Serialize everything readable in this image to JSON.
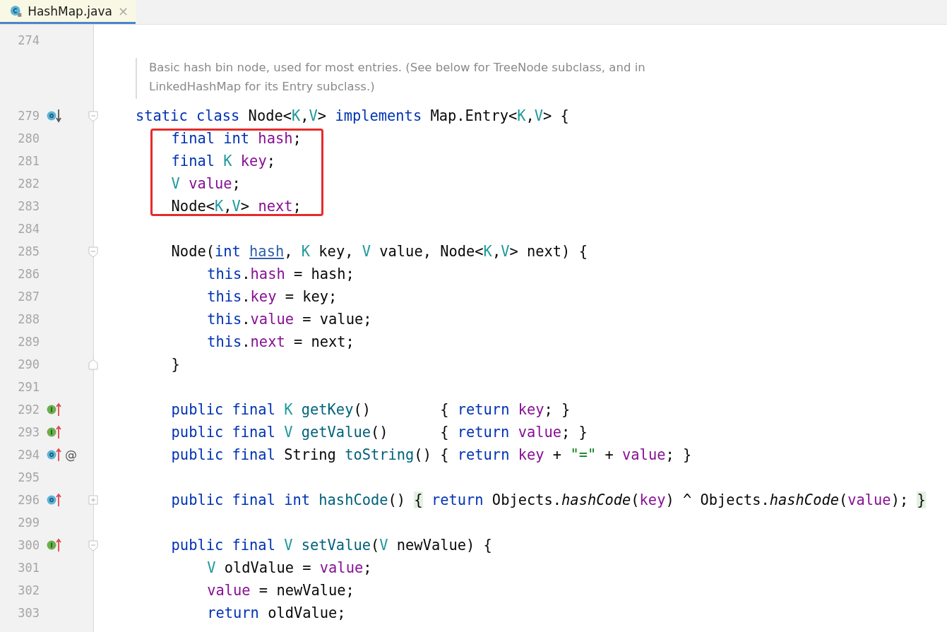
{
  "tab": {
    "label": "HashMap.java",
    "selected": true,
    "close": "×"
  },
  "lines": [
    {
      "number": "274"
    },
    {
      "kind": "doc",
      "text": [
        "Basic hash bin node, used for most entries. (See below for TreeNode subclass, and in",
        "LinkedHashMap for its Entry subclass.)"
      ]
    },
    {
      "number": "279",
      "gutter_icon": {
        "kind": "subclassed"
      },
      "fold": {
        "kind": "start"
      },
      "tokens": [
        {
          "kind": "kw",
          "t": "static class"
        },
        {
          "kind": "plain",
          "t": " Node<"
        },
        {
          "kind": "type",
          "t": "K"
        },
        {
          "kind": "plain",
          "t": ","
        },
        {
          "kind": "type",
          "t": "V"
        },
        {
          "kind": "plain",
          "t": "> "
        },
        {
          "kind": "kw",
          "t": "implements"
        },
        {
          "kind": "plain",
          "t": " Map.Entry<"
        },
        {
          "kind": "type",
          "t": "K"
        },
        {
          "kind": "plain",
          "t": ","
        },
        {
          "kind": "type",
          "t": "V"
        },
        {
          "kind": "plain",
          "t": "> {"
        }
      ],
      "children": [
        {
          "number": "280",
          "boxed": true,
          "tokens": [
            {
              "kind": "kw",
              "t": "final int "
            },
            {
              "kind": "field",
              "t": "hash"
            },
            {
              "kind": "plain",
              "t": ";"
            }
          ]
        },
        {
          "number": "281",
          "boxed": true,
          "tokens": [
            {
              "kind": "kw",
              "t": "final "
            },
            {
              "kind": "type",
              "t": "K "
            },
            {
              "kind": "field",
              "t": "key"
            },
            {
              "kind": "plain",
              "t": ";"
            }
          ]
        },
        {
          "number": "282",
          "boxed": true,
          "tokens": [
            {
              "kind": "type",
              "t": "V "
            },
            {
              "kind": "field",
              "t": "value"
            },
            {
              "kind": "plain",
              "t": ";"
            }
          ]
        },
        {
          "number": "283",
          "boxed": true,
          "tokens": [
            {
              "kind": "plain",
              "t": "Node<"
            },
            {
              "kind": "type",
              "t": "K"
            },
            {
              "kind": "plain",
              "t": ","
            },
            {
              "kind": "type",
              "t": "V"
            },
            {
              "kind": "plain",
              "t": "> "
            },
            {
              "kind": "field",
              "t": "next"
            },
            {
              "kind": "plain",
              "t": ";"
            }
          ]
        },
        {
          "number": "284"
        },
        {
          "number": "285",
          "fold": {
            "kind": "start"
          },
          "tokens": [
            {
              "kind": "plain",
              "t": "Node("
            },
            {
              "kind": "kw",
              "t": "int "
            },
            {
              "kind": "link",
              "t": "hash"
            },
            {
              "kind": "plain",
              "t": ", "
            },
            {
              "kind": "type",
              "t": "K"
            },
            {
              "kind": "plain",
              "t": " key, "
            },
            {
              "kind": "type",
              "t": "V"
            },
            {
              "kind": "plain",
              "t": " value, Node<"
            },
            {
              "kind": "type",
              "t": "K"
            },
            {
              "kind": "plain",
              "t": ","
            },
            {
              "kind": "type",
              "t": "V"
            },
            {
              "kind": "plain",
              "t": "> next) {"
            }
          ],
          "children": [
            {
              "number": "286",
              "tokens": [
                {
                  "kind": "kw",
                  "t": "this"
                },
                {
                  "kind": "plain",
                  "t": "."
                },
                {
                  "kind": "field",
                  "t": "hash"
                },
                {
                  "kind": "plain",
                  "t": " = hash;"
                }
              ]
            },
            {
              "number": "287",
              "tokens": [
                {
                  "kind": "kw",
                  "t": "this"
                },
                {
                  "kind": "plain",
                  "t": "."
                },
                {
                  "kind": "field",
                  "t": "key"
                },
                {
                  "kind": "plain",
                  "t": " = key;"
                }
              ]
            },
            {
              "number": "288",
              "tokens": [
                {
                  "kind": "kw",
                  "t": "this"
                },
                {
                  "kind": "plain",
                  "t": "."
                },
                {
                  "kind": "field",
                  "t": "value"
                },
                {
                  "kind": "plain",
                  "t": " = value;"
                }
              ]
            },
            {
              "number": "289",
              "tokens": [
                {
                  "kind": "kw",
                  "t": "this"
                },
                {
                  "kind": "plain",
                  "t": "."
                },
                {
                  "kind": "field",
                  "t": "next"
                },
                {
                  "kind": "plain",
                  "t": " = next;"
                }
              ]
            }
          ]
        },
        {
          "number": "290",
          "fold": {
            "kind": "end"
          },
          "tokens": [
            {
              "kind": "plain",
              "t": "}"
            }
          ]
        },
        {
          "number": "291"
        },
        {
          "number": "292",
          "gutter_icon": {
            "kind": "implements"
          },
          "tokens": [
            {
              "kind": "kw",
              "t": "public final "
            },
            {
              "kind": "type",
              "t": "K "
            },
            {
              "kind": "decl",
              "t": "getKey"
            },
            {
              "kind": "plain",
              "t": "()        { "
            },
            {
              "kind": "kw",
              "t": "return "
            },
            {
              "kind": "field",
              "t": "key"
            },
            {
              "kind": "plain",
              "t": "; }"
            }
          ]
        },
        {
          "number": "293",
          "gutter_icon": {
            "kind": "implements"
          },
          "tokens": [
            {
              "kind": "kw",
              "t": "public final "
            },
            {
              "kind": "type",
              "t": "V "
            },
            {
              "kind": "decl",
              "t": "getValue"
            },
            {
              "kind": "plain",
              "t": "()      { "
            },
            {
              "kind": "kw",
              "t": "return "
            },
            {
              "kind": "field",
              "t": "value"
            },
            {
              "kind": "plain",
              "t": "; }"
            }
          ]
        },
        {
          "number": "294",
          "gutter_icon": {
            "kind": "overrides"
          },
          "gutter_mark": "@",
          "tokens": [
            {
              "kind": "kw",
              "t": "public final"
            },
            {
              "kind": "plain",
              "t": " String "
            },
            {
              "kind": "decl",
              "t": "toString"
            },
            {
              "kind": "plain",
              "t": "() { "
            },
            {
              "kind": "kw",
              "t": "return "
            },
            {
              "kind": "field",
              "t": "key"
            },
            {
              "kind": "plain",
              "t": " + "
            },
            {
              "kind": "str",
              "t": "\"=\""
            },
            {
              "kind": "plain",
              "t": " + "
            },
            {
              "kind": "field",
              "t": "value"
            },
            {
              "kind": "plain",
              "t": "; }"
            }
          ]
        },
        {
          "number": "295"
        },
        {
          "number": "296",
          "gutter_icon": {
            "kind": "overrides"
          },
          "fold": {
            "kind": "collapsed"
          },
          "tokens": [
            {
              "kind": "kw",
              "t": "public final int "
            },
            {
              "kind": "decl",
              "t": "hashCode"
            },
            {
              "kind": "plain",
              "t": "() "
            },
            {
              "kind": "folded",
              "t": "{"
            },
            {
              "kind": "kw",
              "t": " return"
            },
            {
              "kind": "plain",
              "t": " Objects."
            },
            {
              "kind": "italic",
              "t": "hashCode"
            },
            {
              "kind": "plain",
              "t": "("
            },
            {
              "kind": "field",
              "t": "key"
            },
            {
              "kind": "plain",
              "t": ") ^ Objects."
            },
            {
              "kind": "italic",
              "t": "hashCode"
            },
            {
              "kind": "plain",
              "t": "("
            },
            {
              "kind": "field",
              "t": "value"
            },
            {
              "kind": "plain",
              "t": "); "
            },
            {
              "kind": "folded",
              "t": "}"
            }
          ]
        },
        {
          "number": "299"
        },
        {
          "number": "300",
          "gutter_icon": {
            "kind": "implements"
          },
          "fold": {
            "kind": "start"
          },
          "tokens": [
            {
              "kind": "kw",
              "t": "public final "
            },
            {
              "kind": "type",
              "t": "V "
            },
            {
              "kind": "decl",
              "t": "setValue"
            },
            {
              "kind": "plain",
              "t": "("
            },
            {
              "kind": "type",
              "t": "V"
            },
            {
              "kind": "plain",
              "t": " newValue) {"
            }
          ],
          "children": [
            {
              "number": "301",
              "tokens": [
                {
                  "kind": "type",
                  "t": "V"
                },
                {
                  "kind": "plain",
                  "t": " oldValue = "
                },
                {
                  "kind": "field",
                  "t": "value"
                },
                {
                  "kind": "plain",
                  "t": ";"
                }
              ]
            },
            {
              "number": "302",
              "tokens": [
                {
                  "kind": "field",
                  "t": "value"
                },
                {
                  "kind": "plain",
                  "t": " = newValue;"
                }
              ]
            },
            {
              "number": "303",
              "tokens": [
                {
                  "kind": "kw",
                  "t": "return"
                },
                {
                  "kind": "plain",
                  "t": " oldValue;"
                }
              ]
            }
          ]
        }
      ]
    }
  ]
}
